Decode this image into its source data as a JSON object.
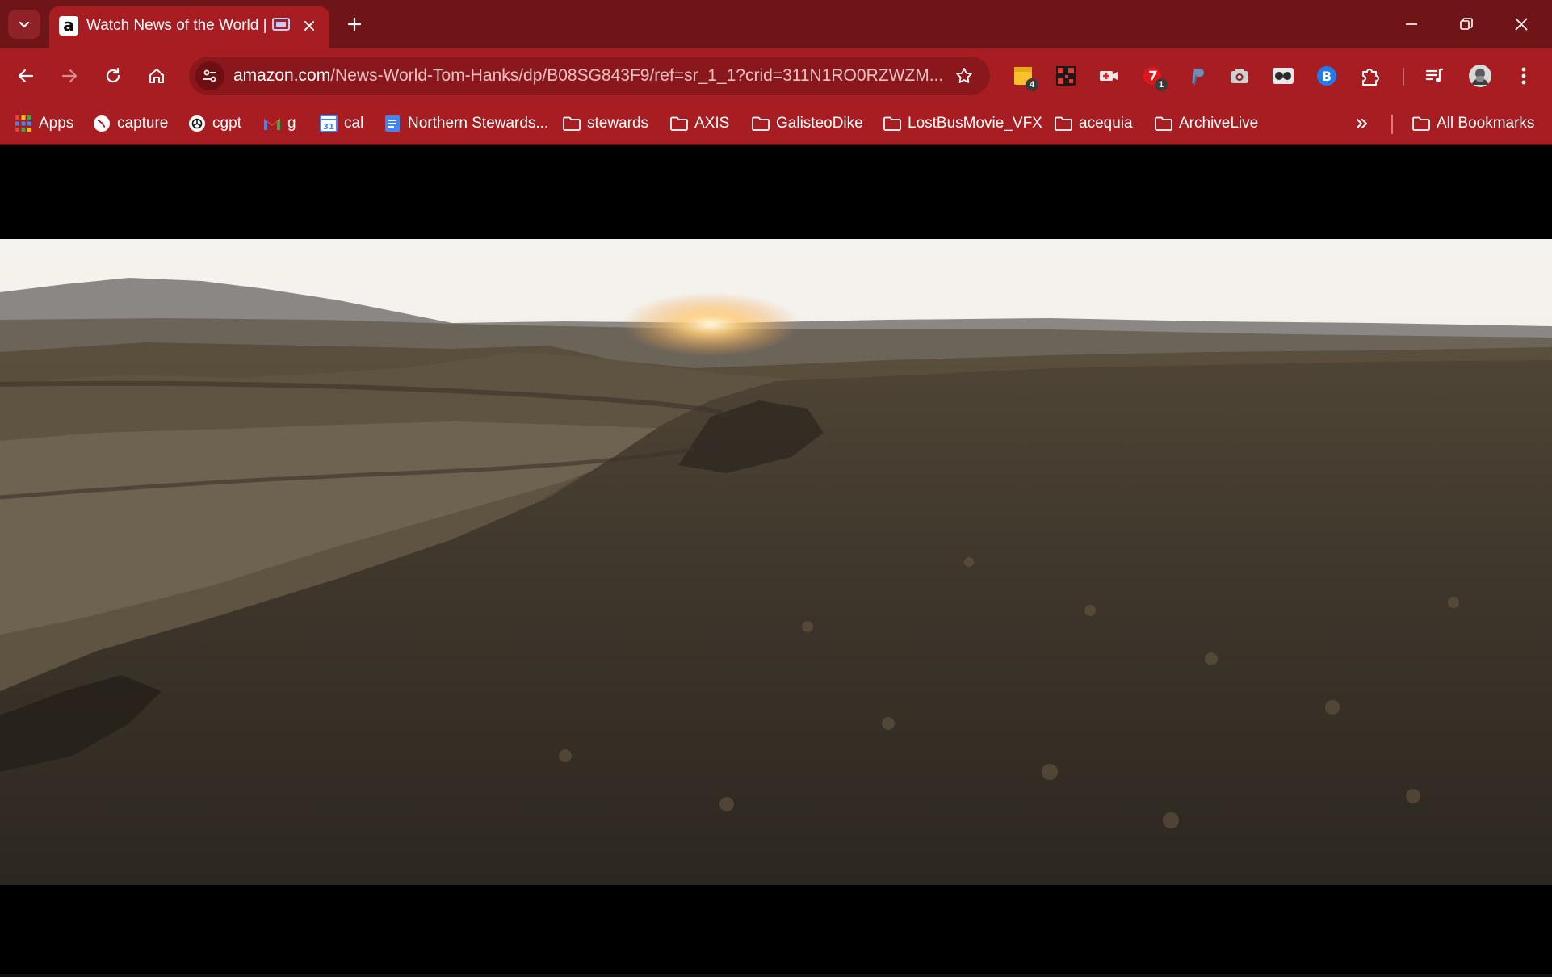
{
  "browser": {
    "tab": {
      "title": "Watch News of the World |",
      "favicon_letter": "a"
    },
    "address_bar": {
      "url_host": "amazon.com",
      "url_path": "/News-World-Tom-Hanks/dp/B08SG843F9/ref=sr_1_1?crid=311N1RO0RZWZM..."
    },
    "extensions": [
      {
        "name": "sticky-notes-extension",
        "badge": "4"
      },
      {
        "name": "qr-code-extension",
        "badge": ""
      },
      {
        "name": "video-extension",
        "badge": ""
      },
      {
        "name": "red-extension",
        "badge": "1"
      },
      {
        "name": "paypal-extension",
        "badge": ""
      },
      {
        "name": "screenshot-extension",
        "badge": ""
      },
      {
        "name": "glasses-extension",
        "badge": ""
      },
      {
        "name": "bitwarden-extension",
        "badge": ""
      }
    ],
    "bookmarks": [
      {
        "label": "Apps",
        "icon": "apps-grid-icon"
      },
      {
        "label": "capture",
        "icon": "globe-icon"
      },
      {
        "label": "cgpt",
        "icon": "openai-icon"
      },
      {
        "label": "g",
        "icon": "gmail-icon"
      },
      {
        "label": "cal",
        "icon": "calendar-icon"
      },
      {
        "label": "Northern Stewards...",
        "icon": "docs-icon"
      },
      {
        "label": "stewards",
        "icon": "folder-icon"
      },
      {
        "label": "AXIS",
        "icon": "folder-icon"
      },
      {
        "label": "GalisteoDike",
        "icon": "folder-icon"
      },
      {
        "label": "LostBusMovie_VFX",
        "icon": "folder-icon"
      },
      {
        "label": "acequia",
        "icon": "folder-icon"
      },
      {
        "label": "ArchiveLive",
        "icon": "folder-icon"
      }
    ],
    "all_bookmarks_label": "All Bookmarks",
    "colors": {
      "frame": "#6f1417",
      "toolbar": "#a81d22",
      "omnibox": "#8a171b"
    }
  },
  "video": {
    "scene": "desert mesa landscape at sunrise"
  }
}
